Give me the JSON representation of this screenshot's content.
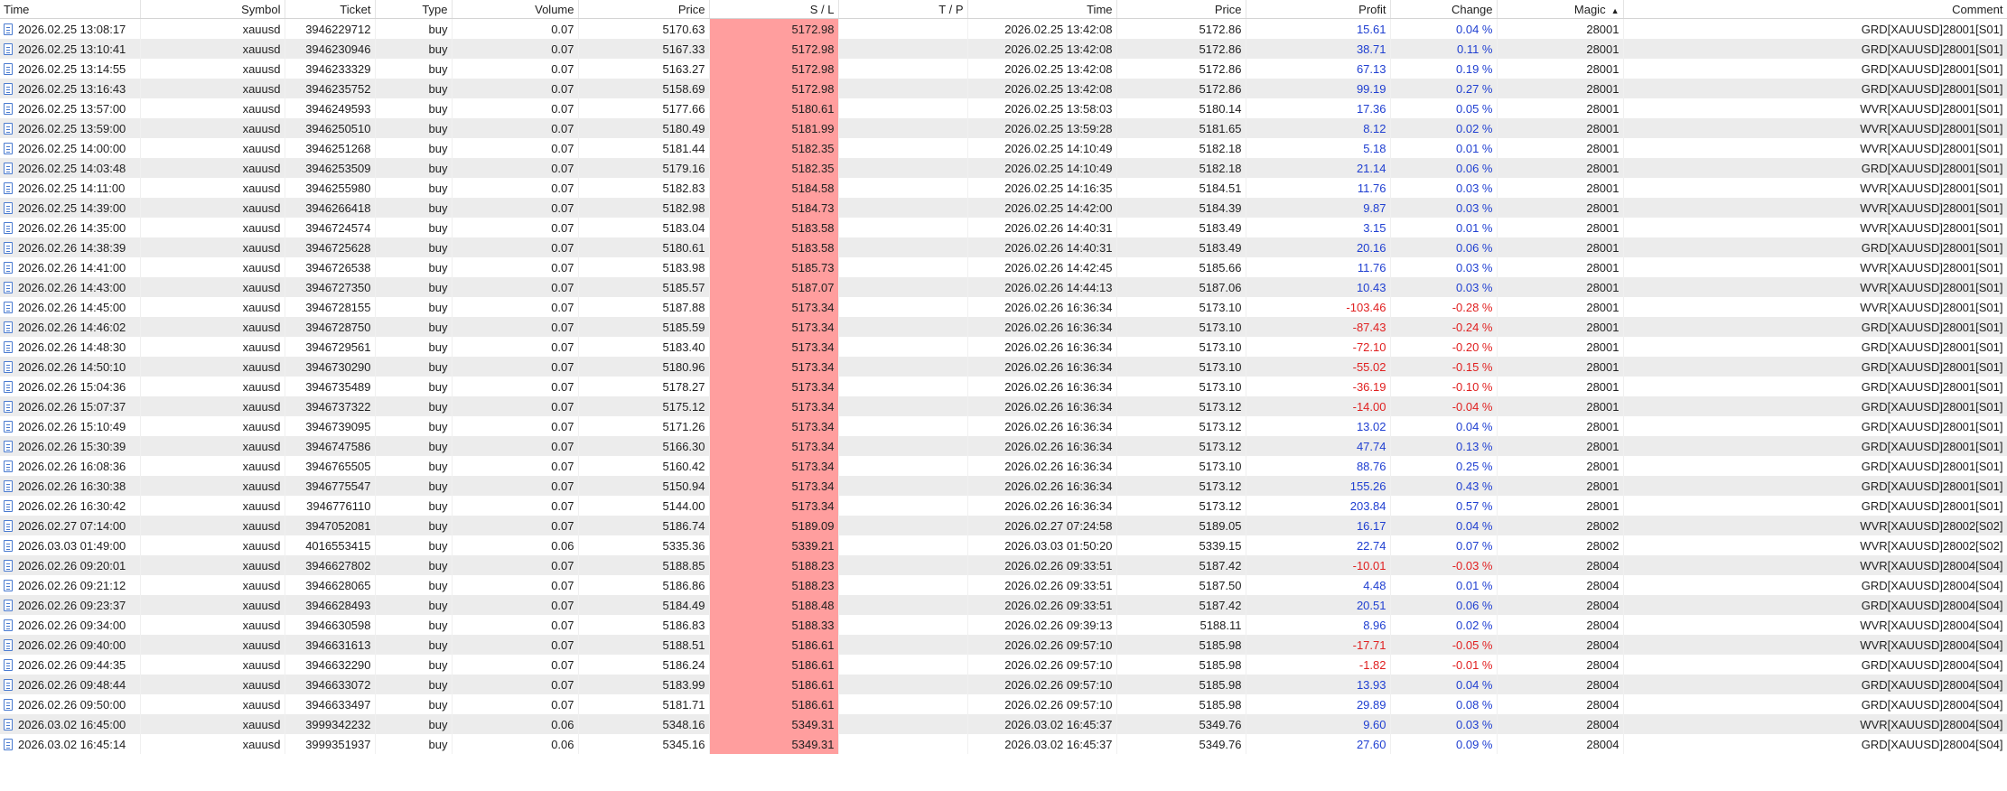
{
  "columns": {
    "time": "Time",
    "symbol": "Symbol",
    "ticket": "Ticket",
    "type": "Type",
    "volume": "Volume",
    "price": "Price",
    "sl": "S / L",
    "tp": "T / P",
    "close_time": "Time",
    "close_price": "Price",
    "profit": "Profit",
    "change": "Change",
    "magic": "Magic",
    "comment": "Comment",
    "sort_indicator": "▲"
  },
  "colors": {
    "sl_highlight": "#ff9e9e",
    "profit_positive": "#1f3fd1",
    "profit_negative": "#e02020"
  },
  "rows": [
    {
      "time": "2026.02.25 13:08:17",
      "symbol": "xauusd",
      "ticket": "3946229712",
      "type": "buy",
      "volume": "0.07",
      "price": "5170.63",
      "sl": "5172.98",
      "tp": "",
      "close_time": "2026.02.25 13:42:08",
      "close_price": "5172.86",
      "profit": "15.61",
      "change": "0.04 %",
      "magic": "28001",
      "comment": "GRD[XAUUSD]28001[S01]"
    },
    {
      "time": "2026.02.25 13:10:41",
      "symbol": "xauusd",
      "ticket": "3946230946",
      "type": "buy",
      "volume": "0.07",
      "price": "5167.33",
      "sl": "5172.98",
      "tp": "",
      "close_time": "2026.02.25 13:42:08",
      "close_price": "5172.86",
      "profit": "38.71",
      "change": "0.11 %",
      "magic": "28001",
      "comment": "GRD[XAUUSD]28001[S01]"
    },
    {
      "time": "2026.02.25 13:14:55",
      "symbol": "xauusd",
      "ticket": "3946233329",
      "type": "buy",
      "volume": "0.07",
      "price": "5163.27",
      "sl": "5172.98",
      "tp": "",
      "close_time": "2026.02.25 13:42:08",
      "close_price": "5172.86",
      "profit": "67.13",
      "change": "0.19 %",
      "magic": "28001",
      "comment": "GRD[XAUUSD]28001[S01]"
    },
    {
      "time": "2026.02.25 13:16:43",
      "symbol": "xauusd",
      "ticket": "3946235752",
      "type": "buy",
      "volume": "0.07",
      "price": "5158.69",
      "sl": "5172.98",
      "tp": "",
      "close_time": "2026.02.25 13:42:08",
      "close_price": "5172.86",
      "profit": "99.19",
      "change": "0.27 %",
      "magic": "28001",
      "comment": "GRD[XAUUSD]28001[S01]"
    },
    {
      "time": "2026.02.25 13:57:00",
      "symbol": "xauusd",
      "ticket": "3946249593",
      "type": "buy",
      "volume": "0.07",
      "price": "5177.66",
      "sl": "5180.61",
      "tp": "",
      "close_time": "2026.02.25 13:58:03",
      "close_price": "5180.14",
      "profit": "17.36",
      "change": "0.05 %",
      "magic": "28001",
      "comment": "WVR[XAUUSD]28001[S01]"
    },
    {
      "time": "2026.02.25 13:59:00",
      "symbol": "xauusd",
      "ticket": "3946250510",
      "type": "buy",
      "volume": "0.07",
      "price": "5180.49",
      "sl": "5181.99",
      "tp": "",
      "close_time": "2026.02.25 13:59:28",
      "close_price": "5181.65",
      "profit": "8.12",
      "change": "0.02 %",
      "magic": "28001",
      "comment": "WVR[XAUUSD]28001[S01]"
    },
    {
      "time": "2026.02.25 14:00:00",
      "symbol": "xauusd",
      "ticket": "3946251268",
      "type": "buy",
      "volume": "0.07",
      "price": "5181.44",
      "sl": "5182.35",
      "tp": "",
      "close_time": "2026.02.25 14:10:49",
      "close_price": "5182.18",
      "profit": "5.18",
      "change": "0.01 %",
      "magic": "28001",
      "comment": "WVR[XAUUSD]28001[S01]"
    },
    {
      "time": "2026.02.25 14:03:48",
      "symbol": "xauusd",
      "ticket": "3946253509",
      "type": "buy",
      "volume": "0.07",
      "price": "5179.16",
      "sl": "5182.35",
      "tp": "",
      "close_time": "2026.02.25 14:10:49",
      "close_price": "5182.18",
      "profit": "21.14",
      "change": "0.06 %",
      "magic": "28001",
      "comment": "GRD[XAUUSD]28001[S01]"
    },
    {
      "time": "2026.02.25 14:11:00",
      "symbol": "xauusd",
      "ticket": "3946255980",
      "type": "buy",
      "volume": "0.07",
      "price": "5182.83",
      "sl": "5184.58",
      "tp": "",
      "close_time": "2026.02.25 14:16:35",
      "close_price": "5184.51",
      "profit": "11.76",
      "change": "0.03 %",
      "magic": "28001",
      "comment": "WVR[XAUUSD]28001[S01]"
    },
    {
      "time": "2026.02.25 14:39:00",
      "symbol": "xauusd",
      "ticket": "3946266418",
      "type": "buy",
      "volume": "0.07",
      "price": "5182.98",
      "sl": "5184.73",
      "tp": "",
      "close_time": "2026.02.25 14:42:00",
      "close_price": "5184.39",
      "profit": "9.87",
      "change": "0.03 %",
      "magic": "28001",
      "comment": "WVR[XAUUSD]28001[S01]"
    },
    {
      "time": "2026.02.26 14:35:00",
      "symbol": "xauusd",
      "ticket": "3946724574",
      "type": "buy",
      "volume": "0.07",
      "price": "5183.04",
      "sl": "5183.58",
      "tp": "",
      "close_time": "2026.02.26 14:40:31",
      "close_price": "5183.49",
      "profit": "3.15",
      "change": "0.01 %",
      "magic": "28001",
      "comment": "WVR[XAUUSD]28001[S01]"
    },
    {
      "time": "2026.02.26 14:38:39",
      "symbol": "xauusd",
      "ticket": "3946725628",
      "type": "buy",
      "volume": "0.07",
      "price": "5180.61",
      "sl": "5183.58",
      "tp": "",
      "close_time": "2026.02.26 14:40:31",
      "close_price": "5183.49",
      "profit": "20.16",
      "change": "0.06 %",
      "magic": "28001",
      "comment": "GRD[XAUUSD]28001[S01]"
    },
    {
      "time": "2026.02.26 14:41:00",
      "symbol": "xauusd",
      "ticket": "3946726538",
      "type": "buy",
      "volume": "0.07",
      "price": "5183.98",
      "sl": "5185.73",
      "tp": "",
      "close_time": "2026.02.26 14:42:45",
      "close_price": "5185.66",
      "profit": "11.76",
      "change": "0.03 %",
      "magic": "28001",
      "comment": "WVR[XAUUSD]28001[S01]"
    },
    {
      "time": "2026.02.26 14:43:00",
      "symbol": "xauusd",
      "ticket": "3946727350",
      "type": "buy",
      "volume": "0.07",
      "price": "5185.57",
      "sl": "5187.07",
      "tp": "",
      "close_time": "2026.02.26 14:44:13",
      "close_price": "5187.06",
      "profit": "10.43",
      "change": "0.03 %",
      "magic": "28001",
      "comment": "WVR[XAUUSD]28001[S01]"
    },
    {
      "time": "2026.02.26 14:45:00",
      "symbol": "xauusd",
      "ticket": "3946728155",
      "type": "buy",
      "volume": "0.07",
      "price": "5187.88",
      "sl": "5173.34",
      "tp": "",
      "close_time": "2026.02.26 16:36:34",
      "close_price": "5173.10",
      "profit": "-103.46",
      "change": "-0.28 %",
      "magic": "28001",
      "comment": "WVR[XAUUSD]28001[S01]"
    },
    {
      "time": "2026.02.26 14:46:02",
      "symbol": "xauusd",
      "ticket": "3946728750",
      "type": "buy",
      "volume": "0.07",
      "price": "5185.59",
      "sl": "5173.34",
      "tp": "",
      "close_time": "2026.02.26 16:36:34",
      "close_price": "5173.10",
      "profit": "-87.43",
      "change": "-0.24 %",
      "magic": "28001",
      "comment": "GRD[XAUUSD]28001[S01]"
    },
    {
      "time": "2026.02.26 14:48:30",
      "symbol": "xauusd",
      "ticket": "3946729561",
      "type": "buy",
      "volume": "0.07",
      "price": "5183.40",
      "sl": "5173.34",
      "tp": "",
      "close_time": "2026.02.26 16:36:34",
      "close_price": "5173.10",
      "profit": "-72.10",
      "change": "-0.20 %",
      "magic": "28001",
      "comment": "GRD[XAUUSD]28001[S01]"
    },
    {
      "time": "2026.02.26 14:50:10",
      "symbol": "xauusd",
      "ticket": "3946730290",
      "type": "buy",
      "volume": "0.07",
      "price": "5180.96",
      "sl": "5173.34",
      "tp": "",
      "close_time": "2026.02.26 16:36:34",
      "close_price": "5173.10",
      "profit": "-55.02",
      "change": "-0.15 %",
      "magic": "28001",
      "comment": "GRD[XAUUSD]28001[S01]"
    },
    {
      "time": "2026.02.26 15:04:36",
      "symbol": "xauusd",
      "ticket": "3946735489",
      "type": "buy",
      "volume": "0.07",
      "price": "5178.27",
      "sl": "5173.34",
      "tp": "",
      "close_time": "2026.02.26 16:36:34",
      "close_price": "5173.10",
      "profit": "-36.19",
      "change": "-0.10 %",
      "magic": "28001",
      "comment": "GRD[XAUUSD]28001[S01]"
    },
    {
      "time": "2026.02.26 15:07:37",
      "symbol": "xauusd",
      "ticket": "3946737322",
      "type": "buy",
      "volume": "0.07",
      "price": "5175.12",
      "sl": "5173.34",
      "tp": "",
      "close_time": "2026.02.26 16:36:34",
      "close_price": "5173.12",
      "profit": "-14.00",
      "change": "-0.04 %",
      "magic": "28001",
      "comment": "GRD[XAUUSD]28001[S01]"
    },
    {
      "time": "2026.02.26 15:10:49",
      "symbol": "xauusd",
      "ticket": "3946739095",
      "type": "buy",
      "volume": "0.07",
      "price": "5171.26",
      "sl": "5173.34",
      "tp": "",
      "close_time": "2026.02.26 16:36:34",
      "close_price": "5173.12",
      "profit": "13.02",
      "change": "0.04 %",
      "magic": "28001",
      "comment": "GRD[XAUUSD]28001[S01]"
    },
    {
      "time": "2026.02.26 15:30:39",
      "symbol": "xauusd",
      "ticket": "3946747586",
      "type": "buy",
      "volume": "0.07",
      "price": "5166.30",
      "sl": "5173.34",
      "tp": "",
      "close_time": "2026.02.26 16:36:34",
      "close_price": "5173.12",
      "profit": "47.74",
      "change": "0.13 %",
      "magic": "28001",
      "comment": "GRD[XAUUSD]28001[S01]"
    },
    {
      "time": "2026.02.26 16:08:36",
      "symbol": "xauusd",
      "ticket": "3946765505",
      "type": "buy",
      "volume": "0.07",
      "price": "5160.42",
      "sl": "5173.34",
      "tp": "",
      "close_time": "2026.02.26 16:36:34",
      "close_price": "5173.10",
      "profit": "88.76",
      "change": "0.25 %",
      "magic": "28001",
      "comment": "GRD[XAUUSD]28001[S01]"
    },
    {
      "time": "2026.02.26 16:30:38",
      "symbol": "xauusd",
      "ticket": "3946775547",
      "type": "buy",
      "volume": "0.07",
      "price": "5150.94",
      "sl": "5173.34",
      "tp": "",
      "close_time": "2026.02.26 16:36:34",
      "close_price": "5173.12",
      "profit": "155.26",
      "change": "0.43 %",
      "magic": "28001",
      "comment": "GRD[XAUUSD]28001[S01]"
    },
    {
      "time": "2026.02.26 16:30:42",
      "symbol": "xauusd",
      "ticket": "3946776110",
      "type": "buy",
      "volume": "0.07",
      "price": "5144.00",
      "sl": "5173.34",
      "tp": "",
      "close_time": "2026.02.26 16:36:34",
      "close_price": "5173.12",
      "profit": "203.84",
      "change": "0.57 %",
      "magic": "28001",
      "comment": "GRD[XAUUSD]28001[S01]"
    },
    {
      "time": "2026.02.27 07:14:00",
      "symbol": "xauusd",
      "ticket": "3947052081",
      "type": "buy",
      "volume": "0.07",
      "price": "5186.74",
      "sl": "5189.09",
      "tp": "",
      "close_time": "2026.02.27 07:24:58",
      "close_price": "5189.05",
      "profit": "16.17",
      "change": "0.04 %",
      "magic": "28002",
      "comment": "WVR[XAUUSD]28002[S02]"
    },
    {
      "time": "2026.03.03 01:49:00",
      "symbol": "xauusd",
      "ticket": "4016553415",
      "type": "buy",
      "volume": "0.06",
      "price": "5335.36",
      "sl": "5339.21",
      "tp": "",
      "close_time": "2026.03.03 01:50:20",
      "close_price": "5339.15",
      "profit": "22.74",
      "change": "0.07 %",
      "magic": "28002",
      "comment": "WVR[XAUUSD]28002[S02]"
    },
    {
      "time": "2026.02.26 09:20:01",
      "symbol": "xauusd",
      "ticket": "3946627802",
      "type": "buy",
      "volume": "0.07",
      "price": "5188.85",
      "sl": "5188.23",
      "tp": "",
      "close_time": "2026.02.26 09:33:51",
      "close_price": "5187.42",
      "profit": "-10.01",
      "change": "-0.03 %",
      "magic": "28004",
      "comment": "WVR[XAUUSD]28004[S04]"
    },
    {
      "time": "2026.02.26 09:21:12",
      "symbol": "xauusd",
      "ticket": "3946628065",
      "type": "buy",
      "volume": "0.07",
      "price": "5186.86",
      "sl": "5188.23",
      "tp": "",
      "close_time": "2026.02.26 09:33:51",
      "close_price": "5187.50",
      "profit": "4.48",
      "change": "0.01 %",
      "magic": "28004",
      "comment": "GRD[XAUUSD]28004[S04]"
    },
    {
      "time": "2026.02.26 09:23:37",
      "symbol": "xauusd",
      "ticket": "3946628493",
      "type": "buy",
      "volume": "0.07",
      "price": "5184.49",
      "sl": "5188.48",
      "tp": "",
      "close_time": "2026.02.26 09:33:51",
      "close_price": "5187.42",
      "profit": "20.51",
      "change": "0.06 %",
      "magic": "28004",
      "comment": "GRD[XAUUSD]28004[S04]"
    },
    {
      "time": "2026.02.26 09:34:00",
      "symbol": "xauusd",
      "ticket": "3946630598",
      "type": "buy",
      "volume": "0.07",
      "price": "5186.83",
      "sl": "5188.33",
      "tp": "",
      "close_time": "2026.02.26 09:39:13",
      "close_price": "5188.11",
      "profit": "8.96",
      "change": "0.02 %",
      "magic": "28004",
      "comment": "WVR[XAUUSD]28004[S04]"
    },
    {
      "time": "2026.02.26 09:40:00",
      "symbol": "xauusd",
      "ticket": "3946631613",
      "type": "buy",
      "volume": "0.07",
      "price": "5188.51",
      "sl": "5186.61",
      "tp": "",
      "close_time": "2026.02.26 09:57:10",
      "close_price": "5185.98",
      "profit": "-17.71",
      "change": "-0.05 %",
      "magic": "28004",
      "comment": "WVR[XAUUSD]28004[S04]"
    },
    {
      "time": "2026.02.26 09:44:35",
      "symbol": "xauusd",
      "ticket": "3946632290",
      "type": "buy",
      "volume": "0.07",
      "price": "5186.24",
      "sl": "5186.61",
      "tp": "",
      "close_time": "2026.02.26 09:57:10",
      "close_price": "5185.98",
      "profit": "-1.82",
      "change": "-0.01 %",
      "magic": "28004",
      "comment": "GRD[XAUUSD]28004[S04]"
    },
    {
      "time": "2026.02.26 09:48:44",
      "symbol": "xauusd",
      "ticket": "3946633072",
      "type": "buy",
      "volume": "0.07",
      "price": "5183.99",
      "sl": "5186.61",
      "tp": "",
      "close_time": "2026.02.26 09:57:10",
      "close_price": "5185.98",
      "profit": "13.93",
      "change": "0.04 %",
      "magic": "28004",
      "comment": "GRD[XAUUSD]28004[S04]"
    },
    {
      "time": "2026.02.26 09:50:00",
      "symbol": "xauusd",
      "ticket": "3946633497",
      "type": "buy",
      "volume": "0.07",
      "price": "5181.71",
      "sl": "5186.61",
      "tp": "",
      "close_time": "2026.02.26 09:57:10",
      "close_price": "5185.98",
      "profit": "29.89",
      "change": "0.08 %",
      "magic": "28004",
      "comment": "GRD[XAUUSD]28004[S04]"
    },
    {
      "time": "2026.03.02 16:45:00",
      "symbol": "xauusd",
      "ticket": "3999342232",
      "type": "buy",
      "volume": "0.06",
      "price": "5348.16",
      "sl": "5349.31",
      "tp": "",
      "close_time": "2026.03.02 16:45:37",
      "close_price": "5349.76",
      "profit": "9.60",
      "change": "0.03 %",
      "magic": "28004",
      "comment": "WVR[XAUUSD]28004[S04]"
    },
    {
      "time": "2026.03.02 16:45:14",
      "symbol": "xauusd",
      "ticket": "3999351937",
      "type": "buy",
      "volume": "0.06",
      "price": "5345.16",
      "sl": "5349.31",
      "tp": "",
      "close_time": "2026.03.02 16:45:37",
      "close_price": "5349.76",
      "profit": "27.60",
      "change": "0.09 %",
      "magic": "28004",
      "comment": "GRD[XAUUSD]28004[S04]"
    }
  ]
}
